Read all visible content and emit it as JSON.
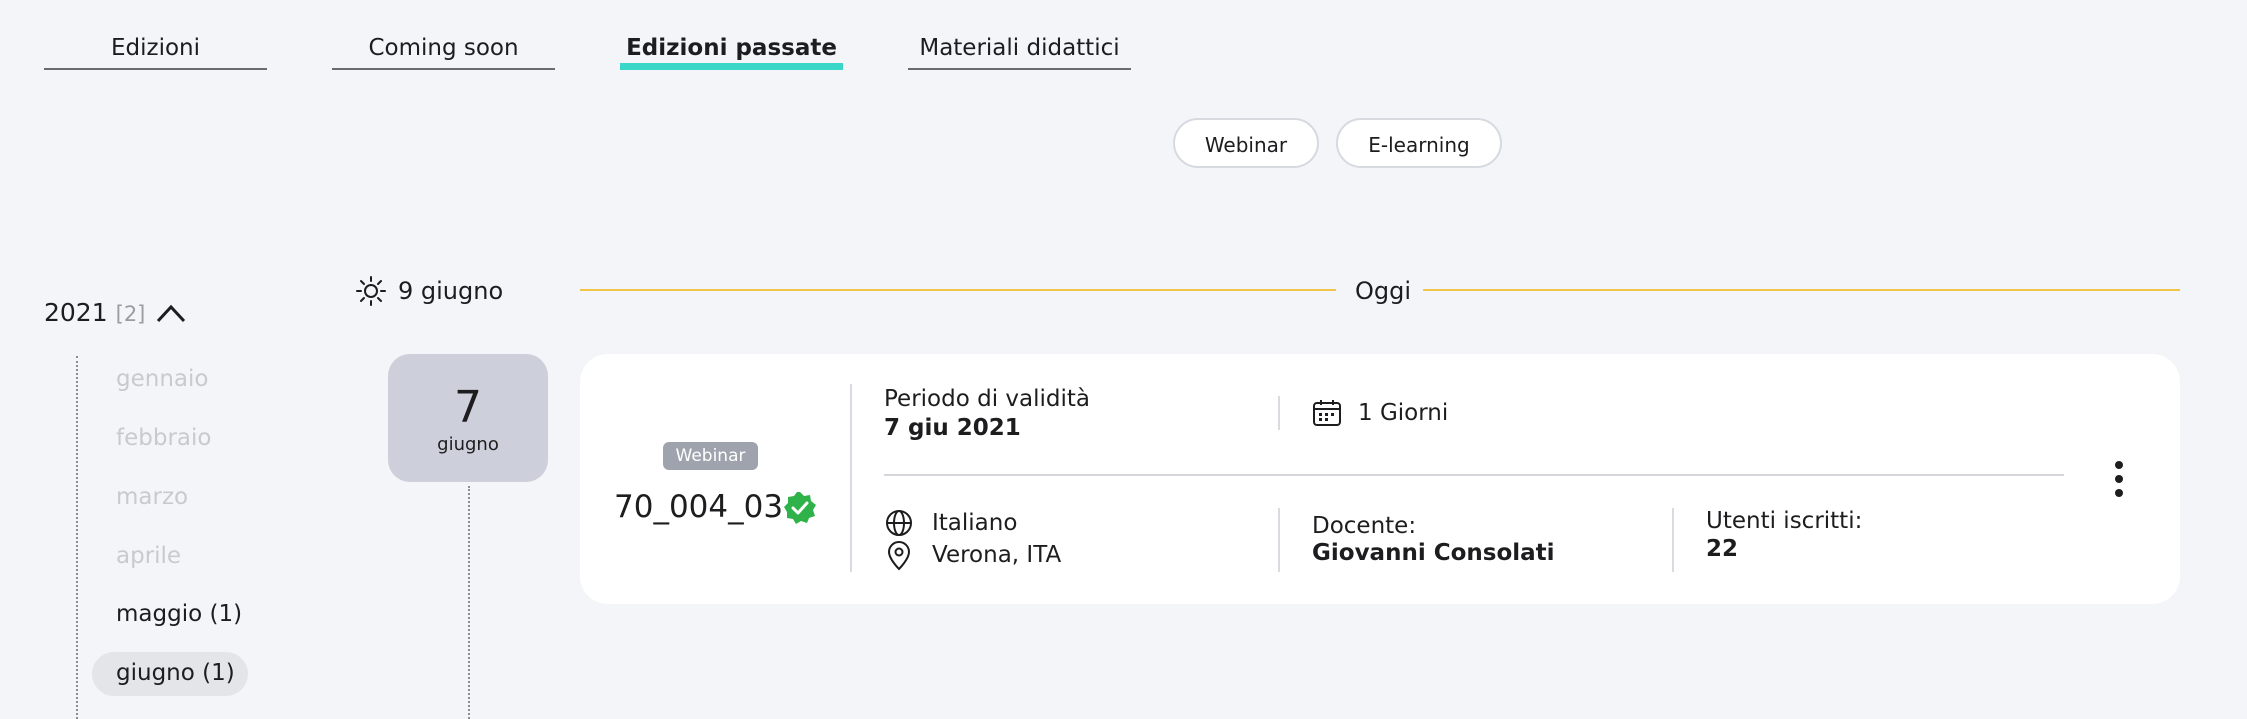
{
  "tabs": [
    {
      "label": "Edizioni"
    },
    {
      "label": "Coming soon"
    },
    {
      "label": "Edizioni passate"
    },
    {
      "label": "Materiali didattici"
    }
  ],
  "filters": [
    {
      "label": "Webinar"
    },
    {
      "label": "E-learning"
    }
  ],
  "sidebar": {
    "year": "2021",
    "year_count": "[2]",
    "months": [
      {
        "label": "gennaio"
      },
      {
        "label": "febbraio"
      },
      {
        "label": "marzo"
      },
      {
        "label": "aprile"
      },
      {
        "label": "maggio (1)"
      },
      {
        "label": "giugno (1)"
      }
    ]
  },
  "timeline": {
    "date_header": "9 giugno",
    "today_label": "Oggi"
  },
  "edition": {
    "day": "7",
    "month": "giugno",
    "type_badge": "Webinar",
    "code": "70_004_03",
    "validity_label": "Periodo di validità",
    "validity_value": "7 giu 2021",
    "duration": "1 Giorni",
    "language": "Italiano",
    "location": "Verona, ITA",
    "teacher_label": "Docente:",
    "teacher_value": "Giovanni Consolati",
    "enrolled_label": "Utenti iscritti:",
    "enrolled_value": "22"
  },
  "colors": {
    "active_tab_underline": "#3ad6c8",
    "today_line": "#f1c54a",
    "verified": "#2fb24a",
    "badge_bg": "#9fa3ad"
  }
}
